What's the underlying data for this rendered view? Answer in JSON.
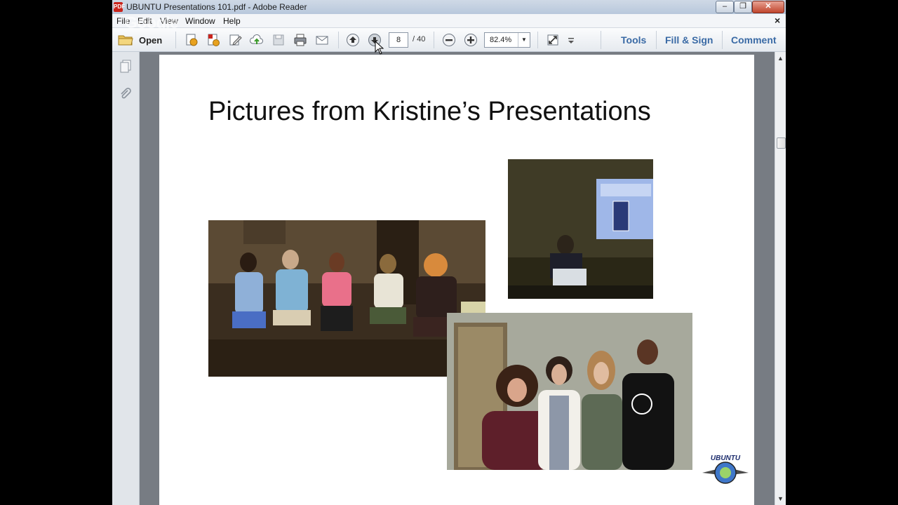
{
  "window": {
    "title": "UBUNTU Presentations 101.pdf - Adobe Reader",
    "minimize": "–",
    "maximize": "❐",
    "close": "✕"
  },
  "menubar": {
    "items": [
      "File",
      "Edit",
      "View",
      "Window",
      "Help"
    ],
    "close_doc": "×"
  },
  "overlay": {
    "google_watermark": "Google"
  },
  "toolbar": {
    "open_label": "Open",
    "current_page": "8",
    "page_total": "/ 40",
    "zoom": "82.4%",
    "tools_label": "Tools",
    "fill_sign_label": "Fill & Sign",
    "comment_label": "Comment"
  },
  "document": {
    "slide_title": "Pictures from Kristine’s Presentations",
    "logo_text": "UBUNTU"
  },
  "colors": {
    "accent_tab": "#3a6aa5",
    "doc_background": "#777c83",
    "pdf_icon": "#c9241c"
  }
}
